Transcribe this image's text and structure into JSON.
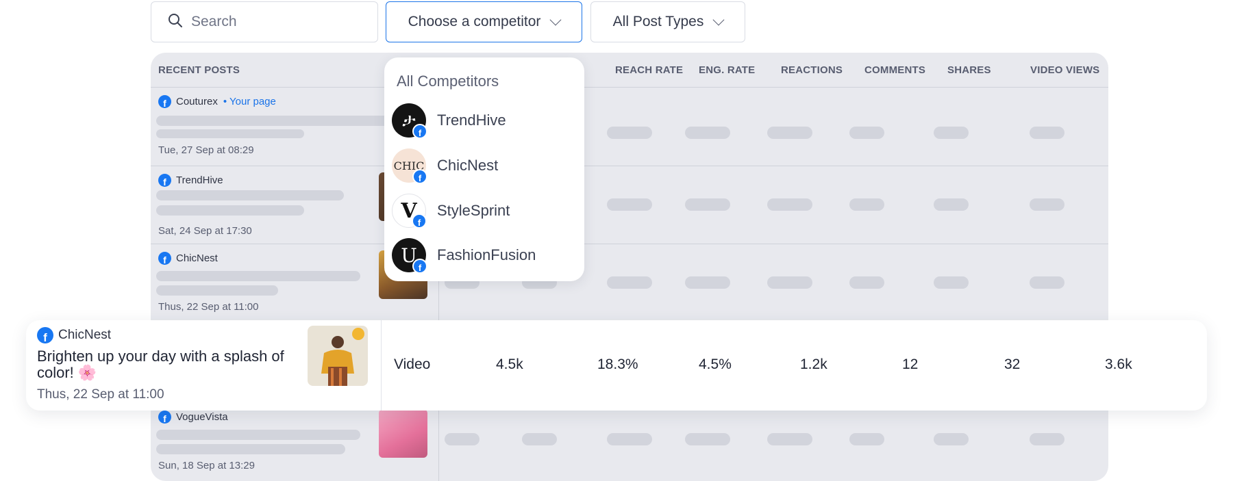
{
  "filters": {
    "search_placeholder": "Search",
    "competitor_label": "Choose a competitor",
    "post_types_label": "All Post Types"
  },
  "table": {
    "headers": {
      "recent_posts": "RECENT POSTS",
      "reach_rate": "REACH RATE",
      "eng_rate": "ENG. RATE",
      "reactions": "REACTIONS",
      "comments": "COMMENTS",
      "shares": "SHARES",
      "video_views": "VIDEO VIEWS"
    },
    "rows": [
      {
        "page": "Couturex",
        "badge": "• Your page",
        "date": "Tue, 27 Sep at 08:29"
      },
      {
        "page": "TrendHive",
        "date": "Sat, 24 Sep at 17:30"
      },
      {
        "page": "ChicNest",
        "date": "Thus, 22 Sep at 11:00"
      },
      {
        "page": "VogueVista",
        "date": "Sun, 18 Sep at 13:29"
      }
    ]
  },
  "dropdown": {
    "all_label": "All Competitors",
    "items": [
      {
        "name": "TrendHive",
        "avatar_text": "ታ"
      },
      {
        "name": "ChicNest",
        "avatar_text": "CHIC"
      },
      {
        "name": "StyleSprint",
        "avatar_text": "V"
      },
      {
        "name": "FashionFusion",
        "avatar_text": "U"
      }
    ]
  },
  "highlight": {
    "page": "ChicNest",
    "caption": "Brighten up your day with a splash of color! 🌸",
    "date": "Thus, 22 Sep at 11:00",
    "type": "Video",
    "reach": "4.5k",
    "reach_rate": "18.3%",
    "eng_rate": "4.5%",
    "reactions": "1.2k",
    "comments": "12",
    "shares": "32",
    "video_views": "3.6k"
  },
  "colors": {
    "accent": "#1a73e8",
    "facebook": "#1877f2",
    "panel_bg": "#e8e9ee",
    "skeleton": "#d2d4dc"
  },
  "icons": {
    "search": "search-icon",
    "chevron": "chevron-down-icon",
    "facebook": "facebook-icon"
  }
}
